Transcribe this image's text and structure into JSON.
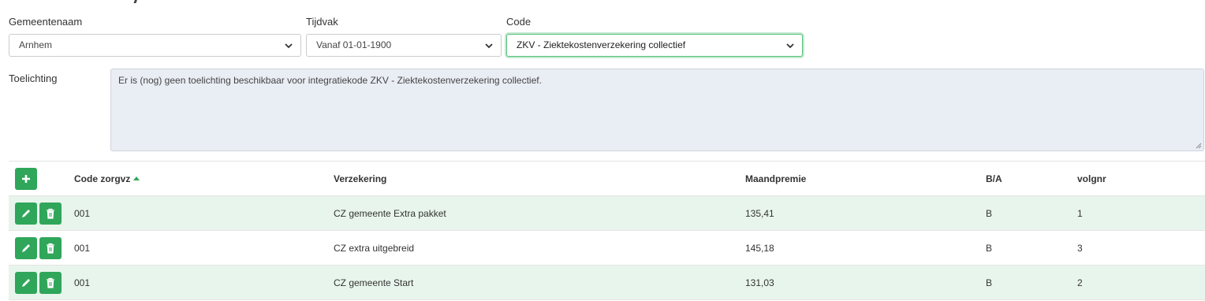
{
  "filters": {
    "gemeente": {
      "label": "Gemeentenaam",
      "value": "Arnhem"
    },
    "tijdvak": {
      "label": "Tijdvak",
      "value": "Vanaf 01-01-1900"
    },
    "code": {
      "label": "Code",
      "value": "ZKV - Ziektekostenverzekering collectief"
    }
  },
  "toelichting": {
    "label": "Toelichting",
    "text": "Er is (nog) geen toelichting beschikbaar voor integratiekode ZKV - Ziektekostenverzekering collectief."
  },
  "table": {
    "columns": {
      "code": "Code zorgvz",
      "verzekering": "Verzekering",
      "premie": "Maandpremie",
      "ba": "B/A",
      "volgnr": "volgnr"
    },
    "sort": "ascending",
    "rows": [
      {
        "code": "001",
        "verzekering": "CZ gemeente Extra pakket",
        "premie": "135,41",
        "ba": "B",
        "volgnr": "1"
      },
      {
        "code": "001",
        "verzekering": "CZ extra uitgebreid",
        "premie": "145,18",
        "ba": "B",
        "volgnr": "3"
      },
      {
        "code": "001",
        "verzekering": "CZ gemeente Start",
        "premie": "131,03",
        "ba": "B",
        "volgnr": "2"
      }
    ]
  },
  "colors": {
    "accent": "#2fa65a",
    "row_alt": "#e8f5ec",
    "textarea_bg": "#e9edf4"
  },
  "icons": {
    "add": "plus-icon",
    "edit": "pencil-icon",
    "delete": "trash-icon",
    "dropdown": "chevron-down-icon"
  }
}
